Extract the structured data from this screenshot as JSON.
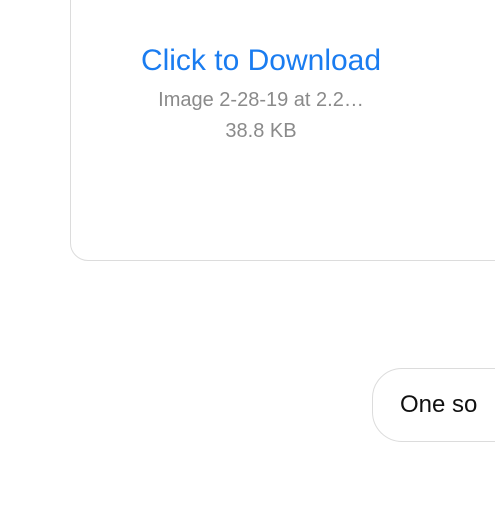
{
  "attachment": {
    "download_label": "Click to Download",
    "file_name": "Image 2-28-19 at 2.2…",
    "file_size": "38.8 KB"
  },
  "message": {
    "text": "One so"
  },
  "colors": {
    "link": "#1a7cf0",
    "meta_text": "#8a8a8a",
    "border": "#dcdcdc"
  }
}
